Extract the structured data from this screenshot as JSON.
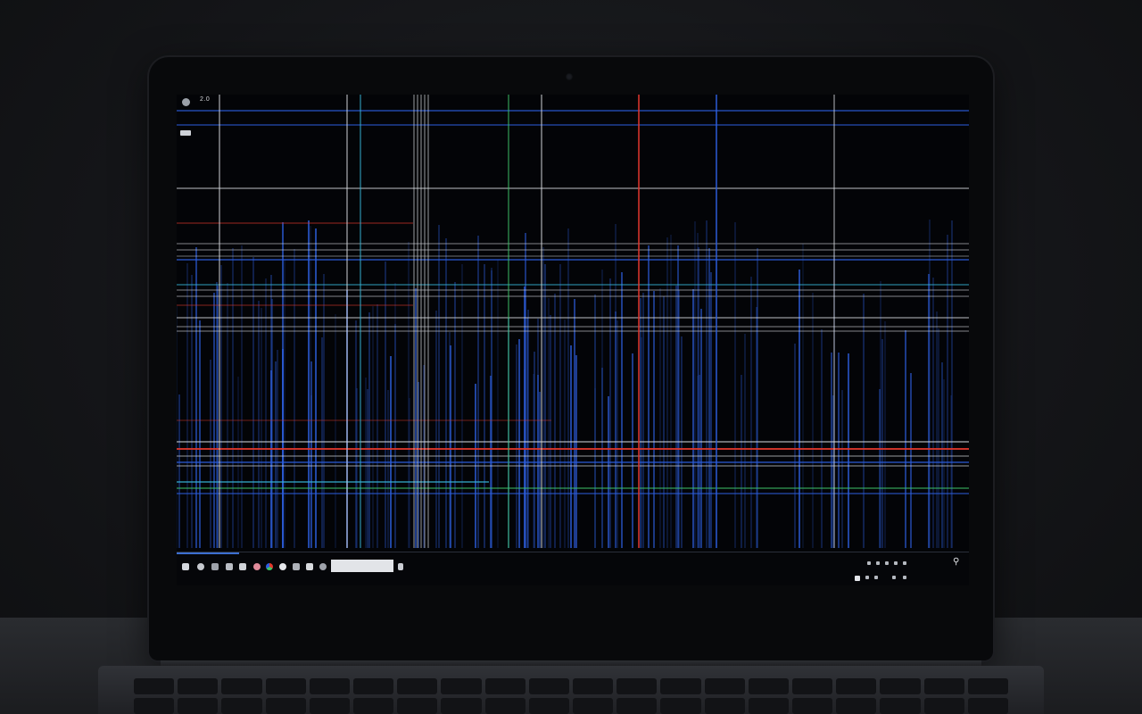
{
  "desktop": {
    "top_label": "2.0",
    "corner_label": "",
    "top_right_label": ""
  },
  "taskbar": {
    "search_placeholder": "",
    "labels": [
      "",
      "",
      ""
    ],
    "clock_time": "",
    "clock_date": "",
    "tray_extra": ""
  },
  "icons": {
    "recycle": "recycle-bin-icon",
    "start": "start-menu-icon",
    "task_view": "task-view-icon",
    "notification": "search-icon"
  },
  "colors": {
    "screen_bg": "#030407",
    "line_blue": "#2d5fe0",
    "line_white": "#d8dbe0",
    "line_red": "#e0382e",
    "line_green": "#3fc46a",
    "line_cyan": "#38b6d8"
  }
}
